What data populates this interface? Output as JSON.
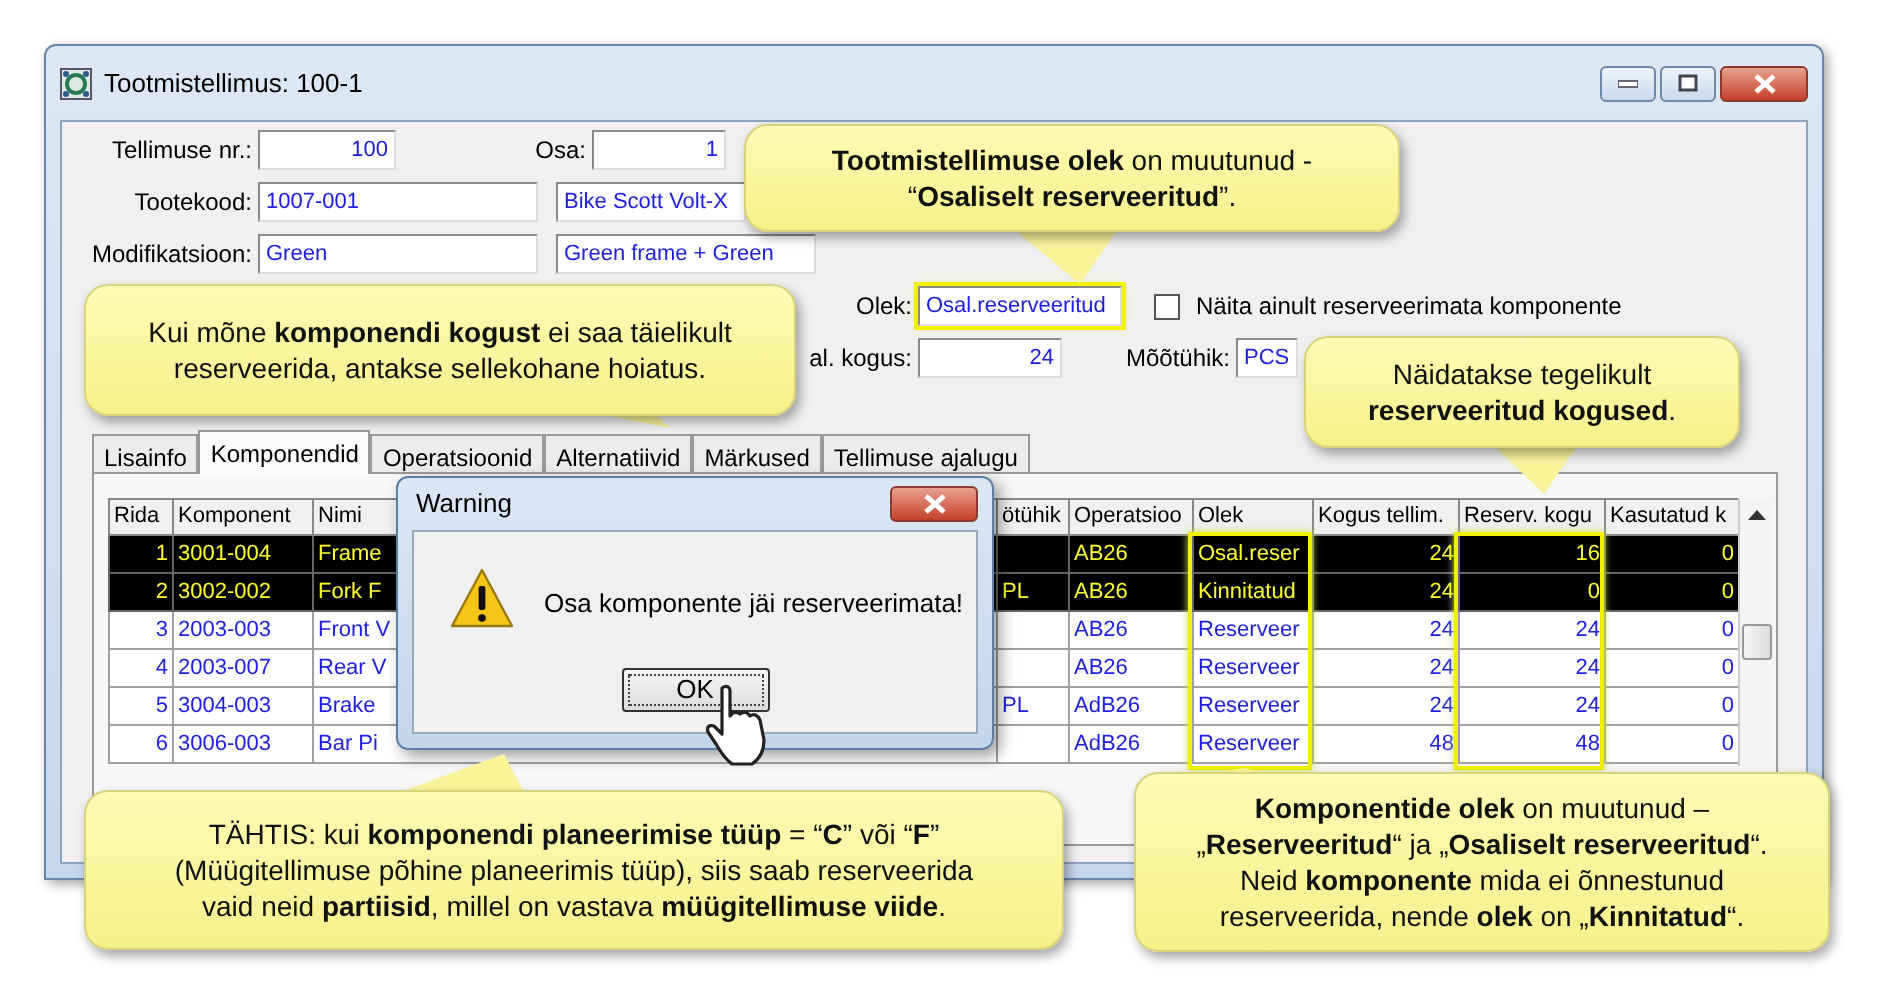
{
  "window": {
    "title": "Tootmistellimus: 100-1"
  },
  "form_rows": [
    [
      {
        "label": "Tellimuse nr.:",
        "value": "100",
        "kind": "number"
      },
      {
        "label": "Osa:",
        "value": "1",
        "kind": "number"
      }
    ],
    [
      {
        "label": "Tootekood:",
        "value": "1007-001",
        "kind": "text"
      },
      {
        "value": "Bike Scott Volt-X",
        "kind": "text"
      }
    ],
    [
      {
        "label": "Modifikatsioon:",
        "value": "Green",
        "kind": "text"
      },
      {
        "value": "Green frame + Green",
        "kind": "text"
      }
    ],
    [
      {
        "label": "Olek:",
        "value": "Osal.reserveeritud",
        "kind": "text",
        "highlighted": true
      },
      {
        "label": "Näita ainult reserveerimata komponente",
        "kind": "checkbox",
        "checked": false
      }
    ],
    [
      {
        "label": "al. kogus:",
        "value": "24",
        "kind": "number"
      },
      {
        "label": "Mõõtühik:",
        "value": "PCS",
        "kind": "text"
      }
    ]
  ],
  "tabs": [
    {
      "label": "Lisainfo",
      "selected": false
    },
    {
      "label": "Komponendid",
      "selected": true
    },
    {
      "label": "Operatsioonid",
      "selected": false
    },
    {
      "label": "Alternatiivid",
      "selected": false
    },
    {
      "label": "Märkused",
      "selected": false
    },
    {
      "label": "Tellimuse ajalugu",
      "selected": false
    }
  ],
  "table": {
    "columns": [
      {
        "label": "Rida",
        "kind": "number"
      },
      {
        "label": "Komponent",
        "kind": "text"
      },
      {
        "label": "Nimi",
        "kind": "text"
      },
      {
        "label": "ötühik",
        "kind": "text"
      },
      {
        "label": "Operatsioo",
        "kind": "text"
      },
      {
        "label": "Olek",
        "kind": "text"
      },
      {
        "label": "Kogus tellim.",
        "kind": "number"
      },
      {
        "label": "Reserv. kogu",
        "kind": "number"
      },
      {
        "label": "Kasutatud k",
        "kind": "number"
      }
    ],
    "rows": [
      {
        "selected": true,
        "cells": [
          "1",
          "3001-004",
          "Frame",
          null,
          "AB26",
          "Osal.reser",
          "24",
          "16",
          "0"
        ]
      },
      {
        "selected": true,
        "cells": [
          "2",
          "3002-002",
          "Fork F",
          "PL",
          "AB26",
          "Kinnitatud",
          "24",
          "0",
          "0"
        ]
      },
      {
        "selected": false,
        "cells": [
          "3",
          "2003-003",
          "Front V",
          null,
          "AB26",
          "Reserveer",
          "24",
          "24",
          "0"
        ]
      },
      {
        "selected": false,
        "cells": [
          "4",
          "2003-007",
          "Rear V",
          null,
          "AB26",
          "Reserveer",
          "24",
          "24",
          "0"
        ]
      },
      {
        "selected": false,
        "cells": [
          "5",
          "3004-003",
          "Brake",
          "PL",
          "AdB26",
          "Reserveer",
          "24",
          "24",
          "0"
        ]
      },
      {
        "selected": false,
        "cells": [
          "6",
          "3006-003",
          "Bar Pi",
          null,
          "AdB26",
          "Reserveer",
          "48",
          "48",
          "0"
        ]
      }
    ]
  },
  "dialog": {
    "title": "Warning",
    "message": "Osa komponente jäi reserveerimata!",
    "button": "OK"
  },
  "callouts": [
    {
      "text": "**Tootmistellimuse olek** on muutunud -\n“**Osaliselt reserveeritud**”."
    },
    {
      "text": "Kui mõne **komponendi kogust** ei saa täielikult\nreserveerida, antakse sellekohane hoiatus."
    },
    {
      "text": "Näidatakse tegelikult\n**reserveeritud kogused**."
    },
    {
      "text": "TÄHTIS: kui **komponendi planeerimise tüüp** = “**C**” või “**F**”\n(Müügitellimuse põhine planeerimis tüüp), siis saab reserveerida\nvaid neid **partiisid**, millel on vastava **müügitellimuse viide**."
    },
    {
      "text": "**Komponentide olek** on muutunud –\n„**Reserveeritud**“ ja „**Osaliselt reserveeritud**“.\nNeid **komponente** mida ei õnnestunud\nreserveerida, nende **olek** on „**Kinnitatud**“."
    }
  ]
}
